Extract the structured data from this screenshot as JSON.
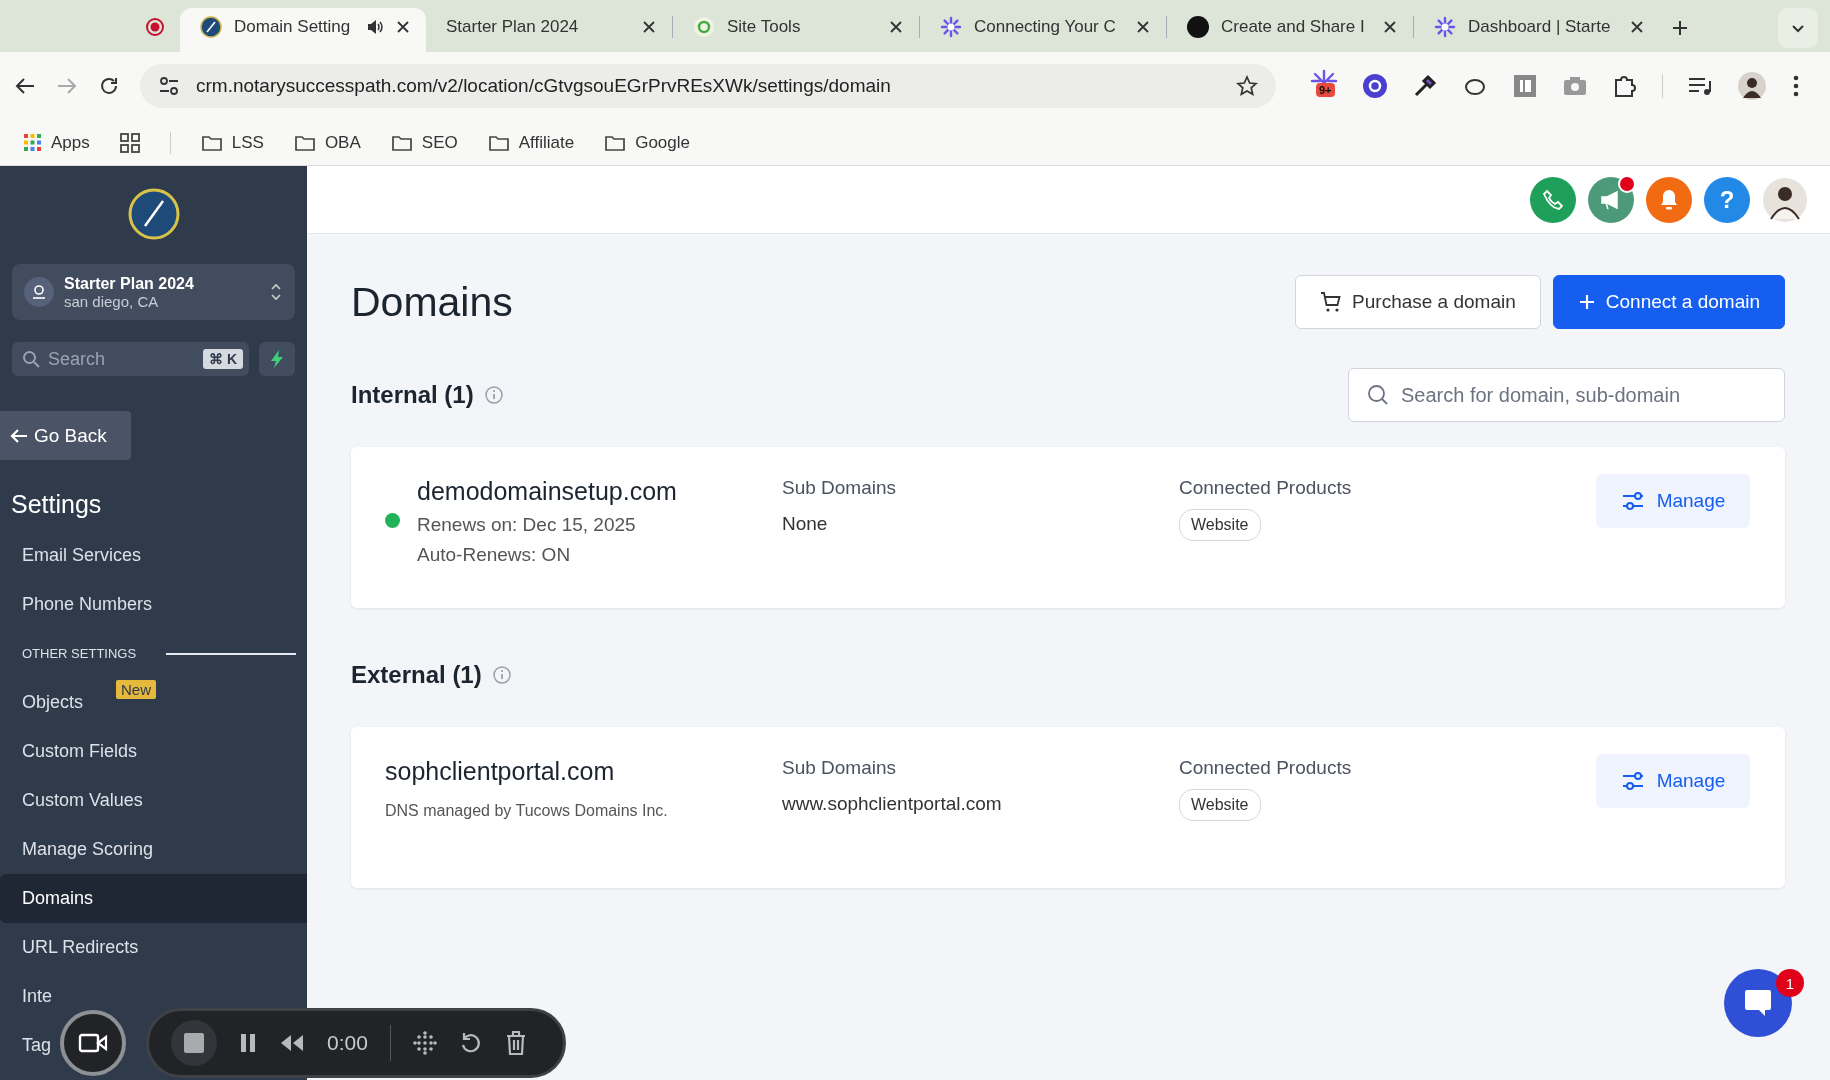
{
  "browser": {
    "tabs": [
      {
        "kind": "recording",
        "selected": false
      },
      {
        "title": "Domain Setting",
        "kind": "app",
        "selected": true,
        "audio": true
      },
      {
        "title": "Starter Plan 2024",
        "kind": "plain",
        "selected": false
      },
      {
        "title": "Site Tools",
        "kind": "sitetools",
        "selected": false
      },
      {
        "title": "Connecting Your C",
        "kind": "burst",
        "selected": false
      },
      {
        "title": "Create and Share I",
        "kind": "sletter",
        "selected": false
      },
      {
        "title": "Dashboard | Starte",
        "kind": "burst",
        "selected": false
      }
    ],
    "url": "crm.notarysuccesspath.com/v2/location/cGtvgsouEGrPrvREsXWk/settings/domain",
    "extension_badge": "9+",
    "bookmarks": [
      {
        "label": "Apps",
        "kind": "apps"
      },
      {
        "kind": "grid"
      },
      {
        "label": "LSS",
        "kind": "folder"
      },
      {
        "label": "OBA",
        "kind": "folder"
      },
      {
        "label": "SEO",
        "kind": "folder"
      },
      {
        "label": "Affiliate",
        "kind": "folder"
      },
      {
        "label": "Google",
        "kind": "folder"
      }
    ]
  },
  "sidebar": {
    "account": {
      "name": "Starter Plan 2024",
      "location": "san diego, CA"
    },
    "search": {
      "placeholder": "Search",
      "shortcut": "⌘ K"
    },
    "back": "Go Back",
    "title": "Settings",
    "items": [
      {
        "kind": "item",
        "label": "Email Services",
        "selected": false
      },
      {
        "kind": "item",
        "label": "Phone Numbers",
        "selected": false
      },
      {
        "kind": "header",
        "label": "OTHER SETTINGS"
      },
      {
        "kind": "item",
        "label": "Objects",
        "selected": false,
        "badge": "New"
      },
      {
        "kind": "item",
        "label": "Custom Fields",
        "selected": false
      },
      {
        "kind": "item",
        "label": "Custom Values",
        "selected": false
      },
      {
        "kind": "item",
        "label": "Manage Scoring",
        "selected": false
      },
      {
        "kind": "item",
        "label": "Domains",
        "selected": true
      },
      {
        "kind": "item",
        "label": "URL Redirects",
        "selected": false
      },
      {
        "kind": "item",
        "label": "Inte",
        "selected": false
      },
      {
        "kind": "item",
        "label": "Tag",
        "selected": false
      }
    ]
  },
  "header": {
    "announcements_unread": true,
    "help": "?"
  },
  "main": {
    "title": "Domains",
    "buttons": [
      {
        "label": "Purchase a domain",
        "kind": "secondary"
      },
      {
        "label": "Connect a domain",
        "kind": "primary"
      }
    ],
    "search": {
      "placeholder": "Search for domain, sub-domain"
    },
    "sections": [
      {
        "title": "Internal (1)",
        "domains": [
          {
            "name": "demodomainsetup.com",
            "kind": "internal",
            "active": true,
            "details": [
              "Renews on: Dec 15, 2025",
              "Auto-Renews: ON"
            ],
            "sub_domains_label": "Sub Domains",
            "sub_domains": "None",
            "products_label": "Connected Products",
            "products": [
              "Website"
            ],
            "action": "Manage"
          }
        ]
      },
      {
        "title": "External (1)",
        "domains": [
          {
            "name": "sophclientportal.com",
            "kind": "external",
            "active": false,
            "details": [
              "DNS managed by Tucows Domains Inc."
            ],
            "sub_domains_label": "Sub Domains",
            "sub_domains": "www.sophclientportal.com",
            "products_label": "Connected Products",
            "products": [
              "Website"
            ],
            "action": "Manage"
          }
        ]
      }
    ]
  },
  "recorder": {
    "time": "0:00"
  },
  "chat": {
    "badge": "1"
  }
}
